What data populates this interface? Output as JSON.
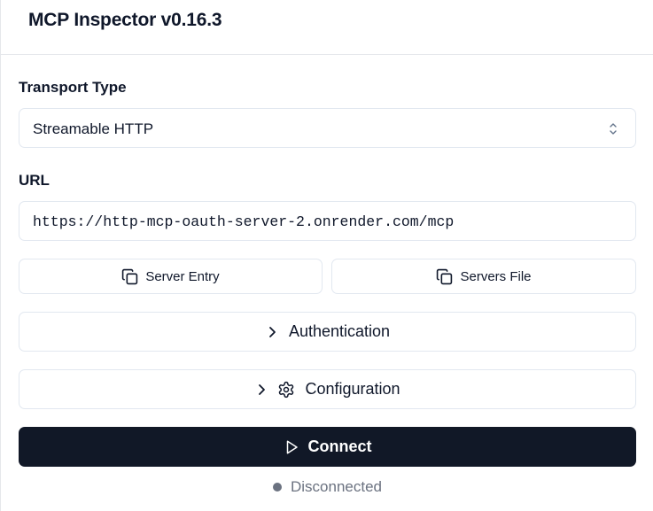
{
  "app": {
    "title": "MCP Inspector v0.16.3"
  },
  "transport": {
    "label": "Transport Type",
    "selected": "Streamable HTTP",
    "icon": "chevrons-up-down-icon"
  },
  "url": {
    "label": "URL",
    "value": "https://http-mcp-oauth-server-2.onrender.com/mcp"
  },
  "copy_buttons": {
    "server_entry": {
      "label": "Server Entry",
      "icon": "copy-icon"
    },
    "servers_file": {
      "label": "Servers File",
      "icon": "copy-icon"
    }
  },
  "sections": {
    "authentication": {
      "label": "Authentication",
      "icon": "chevron-right-icon"
    },
    "configuration": {
      "label": "Configuration",
      "icon": "gear-icon"
    }
  },
  "connect": {
    "label": "Connect",
    "icon": "play-icon",
    "bg_color": "#111827"
  },
  "status": {
    "text": "Disconnected",
    "dot_color": "#6b7280"
  }
}
